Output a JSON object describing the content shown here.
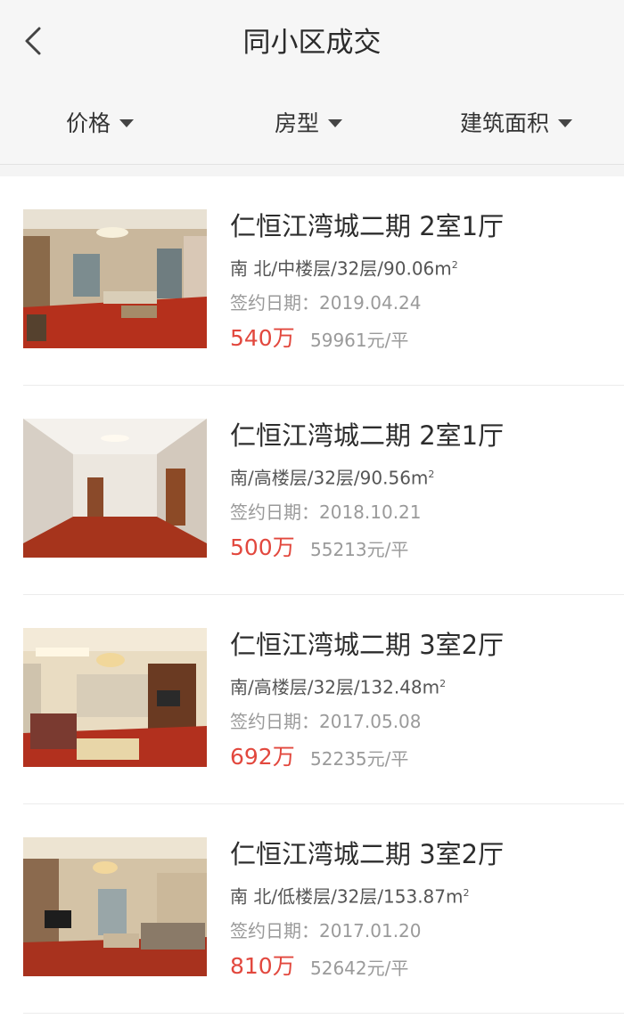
{
  "header": {
    "title": "同小区成交",
    "filters": [
      "价格",
      "房型",
      "建筑面积"
    ]
  },
  "colors": {
    "price_red": "#e2483e",
    "muted_gray": "#9a9a9a",
    "floor_wood": "#b5301c"
  },
  "listings": [
    {
      "name": "仁恒江湾城二期 2室1厅",
      "spec": "南 北/中楼层/32层/90.06m",
      "area_unit_sup": "2",
      "date": "签约日期：2019.04.24",
      "price": "540万",
      "unit_price": "59961元/平"
    },
    {
      "name": "仁恒江湾城二期 2室1厅",
      "spec": "南/高楼层/32层/90.56m",
      "area_unit_sup": "2",
      "date": "签约日期：2018.10.21",
      "price": "500万",
      "unit_price": "55213元/平"
    },
    {
      "name": "仁恒江湾城二期 3室2厅",
      "spec": "南/高楼层/32层/132.48m",
      "area_unit_sup": "2",
      "date": "签约日期：2017.05.08",
      "price": "692万",
      "unit_price": "52235元/平"
    },
    {
      "name": "仁恒江湾城二期 3室2厅",
      "spec": "南 北/低楼层/32层/153.87m",
      "area_unit_sup": "2",
      "date": "签约日期：2017.01.20",
      "price": "810万",
      "unit_price": "52642元/平"
    }
  ]
}
